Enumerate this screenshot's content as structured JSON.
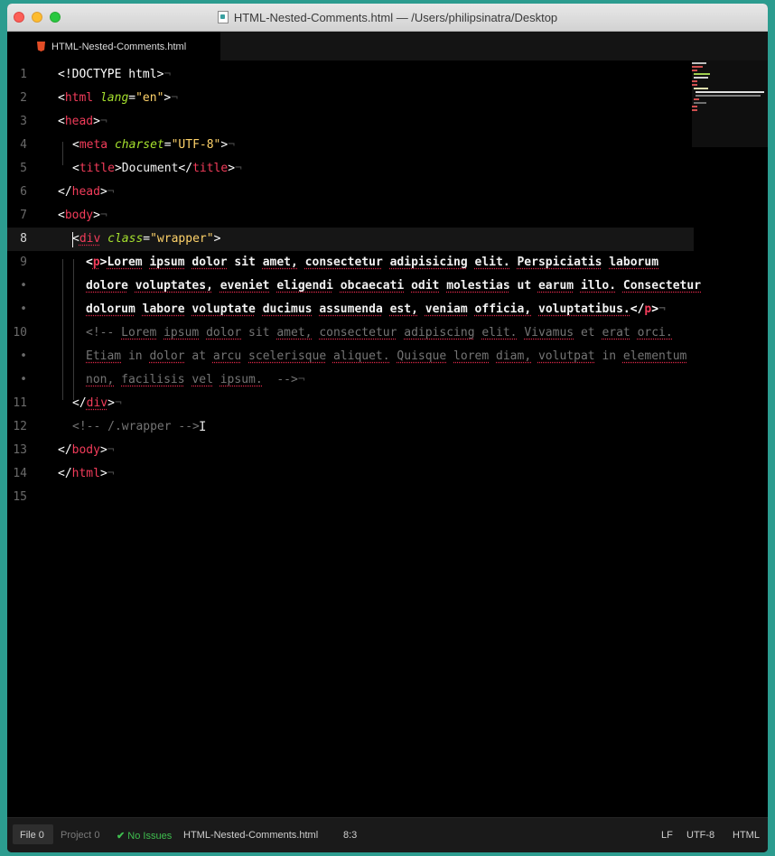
{
  "window": {
    "title": "HTML-Nested-Comments.html — /Users/philipsinatra/Desktop"
  },
  "tab": {
    "label": "HTML-Nested-Comments.html",
    "icon": "html5-icon"
  },
  "editor": {
    "line_numbers": [
      "1",
      "2",
      "3",
      "4",
      "5",
      "6",
      "7",
      "8",
      "9",
      "•",
      "•",
      "10",
      "•",
      "•",
      "11",
      "12",
      "13",
      "14",
      "15"
    ],
    "active_line": "8",
    "l1": {
      "doctype": "<!DOCTYPE html>"
    },
    "l2": {
      "tag": "html",
      "attr": "lang",
      "val": "\"en\""
    },
    "l3": {
      "tag": "head"
    },
    "l4": {
      "tag": "meta",
      "attr": "charset",
      "val": "\"UTF-8\""
    },
    "l5": {
      "tag": "title",
      "text": "Document",
      "close_tag": "title"
    },
    "l6": {
      "tag": "head"
    },
    "l7": {
      "tag": "body"
    },
    "l8": {
      "tag": "div",
      "attr": "class",
      "val": "\"wrapper\""
    },
    "p_tag": "p",
    "p_w1": "Lorem",
    "p_w2": "ipsum",
    "p_w3": "dolor",
    "p_w4": "sit",
    "p_w5": "amet,",
    "p_w6": "consectetur",
    "p_w7": "adipisicing",
    "p_w8": "elit.",
    "p_w9": "Perspiciatis",
    "p_w10": "laborum",
    "p_w11": "dolore",
    "p_w12": "voluptates,",
    "p_w13": "eveniet",
    "p_w14": "eligendi",
    "p_w15": "obcaecati",
    "p_w16": "odit",
    "p_w17": "molestias",
    "p_w18": "ut",
    "p_w19": "earum",
    "p_w20": "illo.",
    "p_w21": "Consectetur",
    "p_w22": "dolorum",
    "p_w23": "labore",
    "p_w24": "voluptate",
    "p_w25": "ducimus",
    "p_w26": "assumenda",
    "p_w27": "est,",
    "p_w28": "veniam",
    "p_w29": "officia,",
    "p_w30": "voluptatibus.",
    "c_open": "<!--",
    "c_w1": "Lorem",
    "c_w2": "ipsum",
    "c_w3": "dolor",
    "c_w4": "sit",
    "c_w5": "amet,",
    "c_w6": "consectetur",
    "c_w7": "adipiscing",
    "c_w8": "elit.",
    "c_w9": "Vivamus",
    "c_w10": "et",
    "c_w11": "erat",
    "c_w12": "orci.",
    "c_w13": "Etiam",
    "c_w14": "in",
    "c_w15": "dolor",
    "c_w16": "at",
    "c_w17": "arcu",
    "c_w18": "scelerisque",
    "c_w19": "aliquet.",
    "c_w20": "Quisque",
    "c_w21": "lorem",
    "c_w22": "diam,",
    "c_w23": "volutpat",
    "c_w24": "in",
    "c_w25": "elementum",
    "c_w26": "non,",
    "c_w27": "facilisis",
    "c_w28": "vel",
    "c_w29": "ipsum.",
    "c_close": "-->",
    "l11": {
      "tag": "div"
    },
    "l12": {
      "comment": "<!-- /.wrapper -->"
    },
    "l13": {
      "tag": "body"
    },
    "l14": {
      "tag": "html"
    },
    "eol_mark": "¬"
  },
  "colors": {
    "tag": "#f23c5a",
    "attribute": "#a6e22e",
    "string": "#ffd36a",
    "comment": "#747474",
    "background": "#000000",
    "window_backdrop": "#2c9c8f"
  },
  "status_bar": {
    "file_label": "File",
    "file_count": "0",
    "project_label": "Project",
    "project_count": "0",
    "issues_icon": "checkmark-icon",
    "issues_label": "No Issues",
    "filename": "HTML-Nested-Comments.html",
    "cursor_position": "8:3",
    "line_ending": "LF",
    "encoding": "UTF-8",
    "grammar": "HTML"
  }
}
